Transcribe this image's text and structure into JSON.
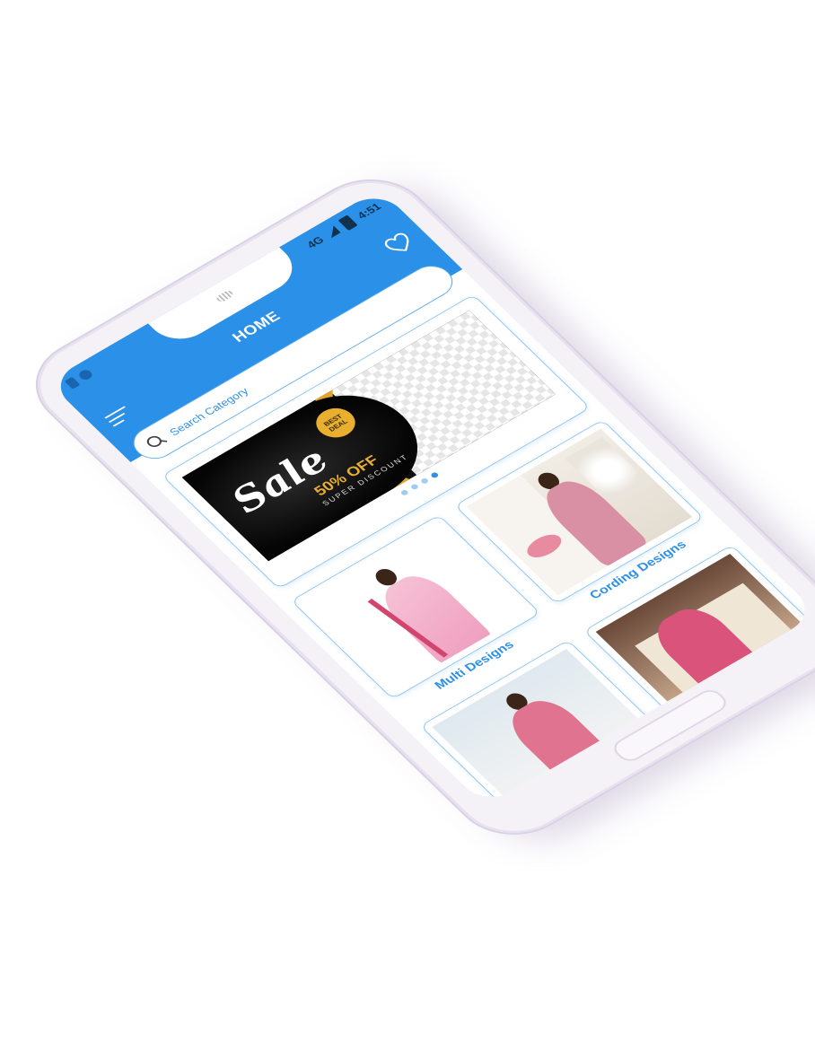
{
  "status_bar": {
    "network": "4G",
    "time": "4:51"
  },
  "header": {
    "title": "HOME"
  },
  "search": {
    "placeholder": "Search Category"
  },
  "banner": {
    "headline": "Sale",
    "discount": "50% OFF",
    "subline": "SUPER DISCOUNT",
    "badge": "BEST DEAL",
    "carousel_dots": 4,
    "active_dot": 3
  },
  "categories": [
    {
      "label": "Cording Designs",
      "saree_color": "#d98fa4"
    },
    {
      "label": "Multi Designs",
      "saree_color": "#f3b6cf"
    },
    {
      "label": "",
      "saree_color": "#d9537a"
    },
    {
      "label": "",
      "saree_color": "#e0738f"
    }
  ],
  "colors": {
    "accent": "#2b90e8",
    "card_border": "#8ec4f2",
    "gold": "#e3a52a"
  }
}
